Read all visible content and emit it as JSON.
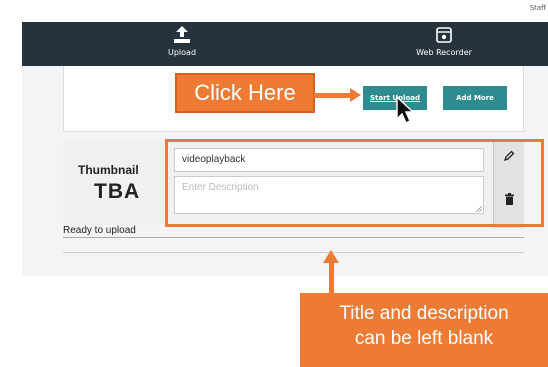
{
  "header": {
    "staff_label": "Staff",
    "nav": [
      {
        "label": "Upload",
        "icon": "upload-icon"
      },
      {
        "label": "Web Recorder",
        "icon": "web-recorder-icon"
      }
    ]
  },
  "upload_panel": {
    "start_upload_label": "Start Upload",
    "add_more_label": "Add More"
  },
  "media_item": {
    "thumbnail_label": "Thumbnail",
    "thumbnail_value": "TBA",
    "title_value": "videoplayback",
    "description_placeholder": "Enter Description",
    "status": "Ready to upload",
    "edit_icon": "pencil-icon",
    "delete_icon": "trash-icon"
  },
  "annotations": {
    "click_here": "Click Here",
    "title_note_line1": "Title and description",
    "title_note_line2": "can be left blank"
  },
  "colors": {
    "nav_bg": "#26323c",
    "button_teal": "#2e8c90",
    "callout_orange": "#ee7b33"
  }
}
